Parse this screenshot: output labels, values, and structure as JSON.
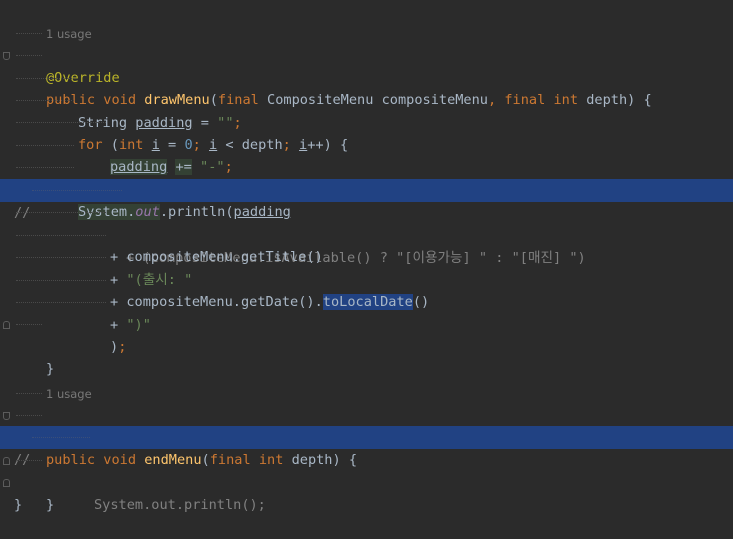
{
  "editor": {
    "usage_hint_1": "1 usage",
    "usage_hint_2": "1 usage",
    "annotation": "@Override",
    "lines": {
      "l2_public": "public",
      "l2_void": "void",
      "l2_name": "drawMenu",
      "l2_open": "(",
      "l2_final1": "final",
      "l2_type": " CompositeMenu compositeMenu",
      "l2_comma": ",",
      "l2_final2": "final",
      "l2_int": "int",
      "l2_rest": " depth) {",
      "l3_type": "String ",
      "l3_var": "padding",
      "l3_eq": " = ",
      "l3_str": "\"\"",
      "l3_semi": ";",
      "l4_for": "for",
      "l4_open": " (",
      "l4_int": "int",
      "l4_i": "i",
      "l4_eq": " = ",
      "l4_zero": "0",
      "l4_semi1": ";",
      "l4_i2": "i",
      "l4_lt": " < depth",
      "l4_semi2": ";",
      "l4_i3": "i",
      "l4_end": "++) {",
      "l5_var": "padding",
      "l5_op": "+=",
      "l5_str": "\"-\"",
      "l5_semi": ";",
      "l6_brace": "}",
      "l7_system": "System.",
      "l7_out": "out",
      "l7_println": ".println(",
      "l7_padding": "padding",
      "l8_comment": "//",
      "l8_text": "+ (compositeMenu.isAvailable() ? \"[이용가능] \" : \"[매진] \")",
      "l9_plus": "+ ",
      "l9_rest": "compositeMenu.getTitle()",
      "l10_plus": "+ ",
      "l10_str": "\"(출시: \"",
      "l11_plus": "+ ",
      "l11_rest": "compositeMenu.getDate().",
      "l11_hl": "toLocalDate",
      "l11_end": "()",
      "l12_plus": "+ ",
      "l12_str": "\")\"",
      "l13_close": ")",
      "l13_semi": ";",
      "l14_brace": "}",
      "l18_public": "public",
      "l18_void": "void",
      "l18_name": "endMenu",
      "l18_open": "(",
      "l18_final": "final",
      "l18_int": "int",
      "l18_rest": " depth) {",
      "l19_comment": "//",
      "l19_text": "System.out.println();",
      "l20_brace": "}",
      "l21_brace": "}"
    }
  },
  "colors": {
    "background": "#2b2b2b",
    "selection": "#214283",
    "keyword": "#cc7832",
    "function": "#ffc66d",
    "string": "#6a8759",
    "annotation": "#bbb529"
  }
}
